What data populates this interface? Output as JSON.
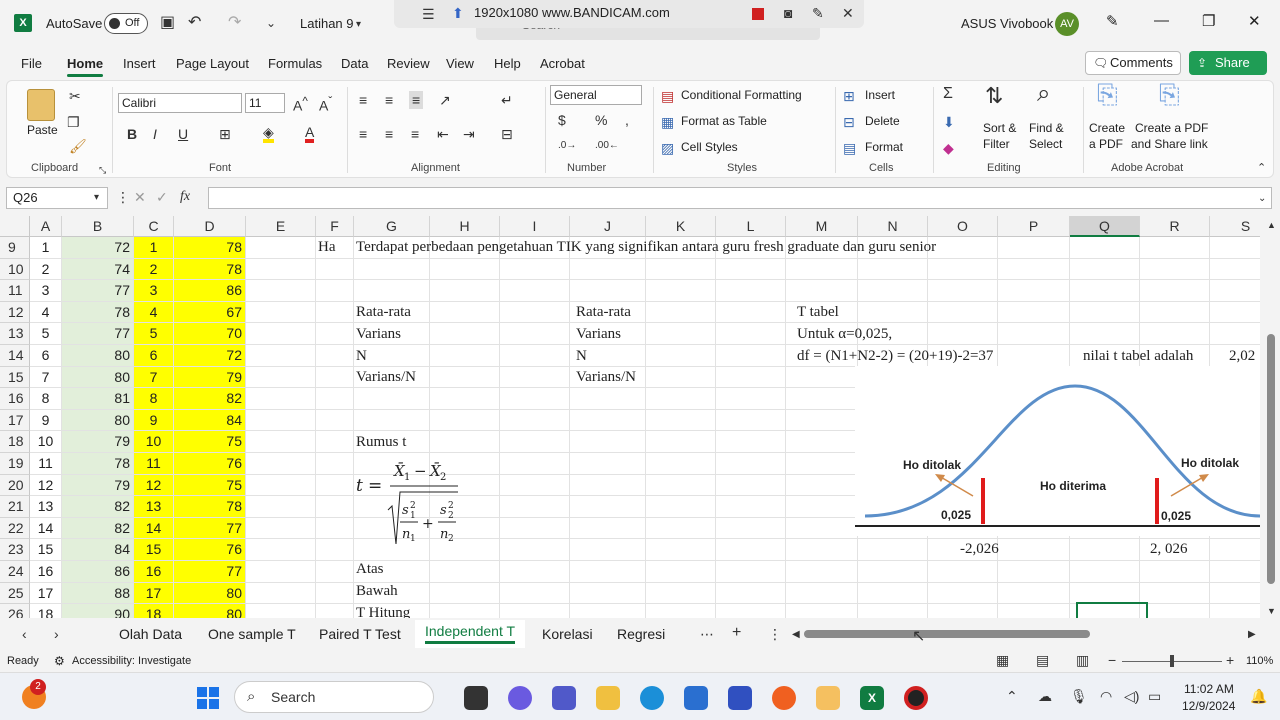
{
  "titlebar": {
    "autosave": "AutoSave",
    "toggle": "Off",
    "filename": "Latihan 9",
    "recorder": "1920x1080  www.BANDICAM.com",
    "search": "Search",
    "user": "ASUS Vivobook",
    "initials": "AV"
  },
  "menu": [
    "File",
    "Home",
    "Insert",
    "Page Layout",
    "Formulas",
    "Data",
    "Review",
    "View",
    "Help",
    "Acrobat"
  ],
  "actions": {
    "comments": "Comments",
    "share": "Share"
  },
  "ribbon": {
    "clipboard": {
      "paste": "Paste",
      "label": "Clipboard"
    },
    "font": {
      "name": "Calibri",
      "size": "11",
      "label": "Font"
    },
    "alignment": {
      "label": "Alignment"
    },
    "number": {
      "format": "General",
      "label": "Number"
    },
    "styles": {
      "cond": "Conditional Formatting",
      "table": "Format as Table",
      "cell": "Cell Styles",
      "label": "Styles"
    },
    "cells": {
      "insert": "Insert",
      "delete": "Delete",
      "format": "Format",
      "label": "Cells"
    },
    "editing": {
      "sort": "Sort &",
      "filter": "Filter",
      "find": "Find &",
      "select": "Select",
      "label": "Editing"
    },
    "acrobat": {
      "create1": "Create",
      "create2": "a PDF",
      "share1": "Create a PDF",
      "share2": "and Share link",
      "label": "Adobe Acrobat"
    }
  },
  "formula_bar": {
    "namebox": "Q26",
    "fx": "fx",
    "value": ""
  },
  "columns": [
    "A",
    "B",
    "C",
    "D",
    "E",
    "F",
    "G",
    "H",
    "I",
    "J",
    "K",
    "L",
    "M",
    "N",
    "O",
    "P",
    "Q",
    "R",
    "S"
  ],
  "rows": [
    {
      "n": "9",
      "a": "1",
      "b": "72",
      "c": "1",
      "d": "78"
    },
    {
      "n": "10",
      "a": "2",
      "b": "74",
      "c": "2",
      "d": "78"
    },
    {
      "n": "11",
      "a": "3",
      "b": "77",
      "c": "3",
      "d": "86"
    },
    {
      "n": "12",
      "a": "4",
      "b": "78",
      "c": "4",
      "d": "67"
    },
    {
      "n": "13",
      "a": "5",
      "b": "77",
      "c": "5",
      "d": "70"
    },
    {
      "n": "14",
      "a": "6",
      "b": "80",
      "c": "6",
      "d": "72"
    },
    {
      "n": "15",
      "a": "7",
      "b": "80",
      "c": "7",
      "d": "79"
    },
    {
      "n": "16",
      "a": "8",
      "b": "81",
      "c": "8",
      "d": "82"
    },
    {
      "n": "17",
      "a": "9",
      "b": "80",
      "c": "9",
      "d": "84"
    },
    {
      "n": "18",
      "a": "10",
      "b": "79",
      "c": "10",
      "d": "75"
    },
    {
      "n": "19",
      "a": "11",
      "b": "78",
      "c": "11",
      "d": "76"
    },
    {
      "n": "20",
      "a": "12",
      "b": "79",
      "c": "12",
      "d": "75"
    },
    {
      "n": "21",
      "a": "13",
      "b": "82",
      "c": "13",
      "d": "78"
    },
    {
      "n": "22",
      "a": "14",
      "b": "82",
      "c": "14",
      "d": "77"
    },
    {
      "n": "23",
      "a": "15",
      "b": "84",
      "c": "15",
      "d": "76"
    },
    {
      "n": "24",
      "a": "16",
      "b": "86",
      "c": "16",
      "d": "77"
    },
    {
      "n": "25",
      "a": "17",
      "b": "88",
      "c": "17",
      "d": "80"
    },
    {
      "n": "26",
      "a": "18",
      "b": "90",
      "c": "18",
      "d": "80"
    }
  ],
  "sheet_text": {
    "ha": "Ha",
    "hypothesis": "Terdapat perbedaan pengetahuan TIK yang signifikan antara guru fresh graduate dan guru senior",
    "rata1": "Rata-rata",
    "varians1": "Varians",
    "n1": "N",
    "vn1": "Varians/N",
    "rata2": "Rata-rata",
    "varians2": "Varians",
    "n2": "N",
    "vn2": "Varians/N",
    "ttabel": "T tabel",
    "alpha": "Untuk α=0,025,",
    "df": "df = (N1+N2-2) = (20+19)-2=37",
    "nilai": "nilai t tabel adalah",
    "nilai_val": "2,02",
    "rumus": "Rumus t",
    "atas": "Atas",
    "bawah": "Bawah",
    "thitung": "T Hitung"
  },
  "curve": {
    "left_reject": "Ho ditolak",
    "accept": "Ho diterima",
    "right_reject": "Ho ditolak",
    "alpha_left": "0,025",
    "alpha_right": "0,025",
    "tick_left": "-2,026",
    "tick_right": "2, 026"
  },
  "tabs": [
    "Olah Data",
    "One sample T",
    "Paired T Test",
    "Independent T",
    "Korelasi",
    "Regresi"
  ],
  "status": {
    "ready": "Ready",
    "access": "Accessibility: Investigate",
    "zoom": "110%"
  },
  "taskbar": {
    "search": "Search",
    "time": "11:02 AM",
    "date": "12/9/2024",
    "badge": "2"
  }
}
